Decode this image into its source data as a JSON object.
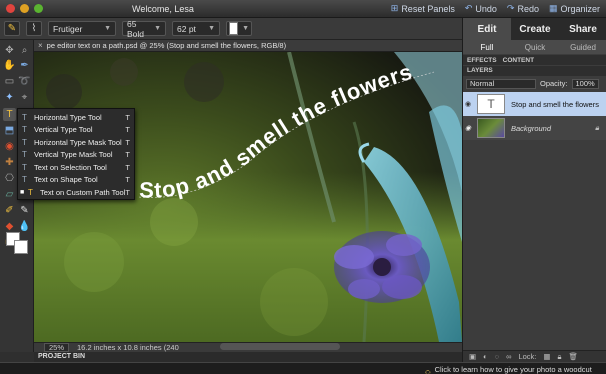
{
  "titlebar": {
    "welcome": "Welcome, Lesa",
    "reset_panels": "Reset Panels",
    "undo": "Undo",
    "redo": "Redo",
    "organizer": "Organizer"
  },
  "options_bar": {
    "font_family": "Frutiger",
    "font_style": "65 Bold",
    "font_size": "62 pt"
  },
  "document": {
    "tab_title": "pe editor text on a path.psd @ 25% (Stop and smell the flowers, RGB/8)",
    "path_text": "Stop and smell the flowers",
    "zoom": "25%",
    "size_info": "16.2 inches x 10.8 inches (240"
  },
  "context_menu": {
    "items": [
      {
        "label": "Horizontal Type Tool",
        "shortcut": "T"
      },
      {
        "label": "Vertical Type Tool",
        "shortcut": "T"
      },
      {
        "label": "Horizontal Type Mask Tool",
        "shortcut": "T"
      },
      {
        "label": "Vertical Type Mask Tool",
        "shortcut": "T"
      },
      {
        "label": "Text on Selection Tool",
        "shortcut": "T"
      },
      {
        "label": "Text on Shape Tool",
        "shortcut": "T"
      },
      {
        "label": "Text on Custom Path Tool",
        "shortcut": "T"
      }
    ]
  },
  "panel": {
    "modes": [
      "Edit",
      "Create",
      "Share"
    ],
    "subtabs": [
      "Full",
      "Quick",
      "Guided"
    ],
    "panel_tabs": [
      "EFFECTS",
      "CONTENT"
    ],
    "layers_header": "LAYERS",
    "blend_mode": "Normal",
    "opacity_label": "Opacity:",
    "opacity_value": "100%",
    "layers": [
      {
        "name": "Stop and smell the flowers",
        "thumb": "T"
      },
      {
        "name": "Background"
      }
    ],
    "lock_label": "Lock:"
  },
  "project_bin": "PROJECT BIN",
  "tip": "Click to learn how to give your photo a woodcut look."
}
